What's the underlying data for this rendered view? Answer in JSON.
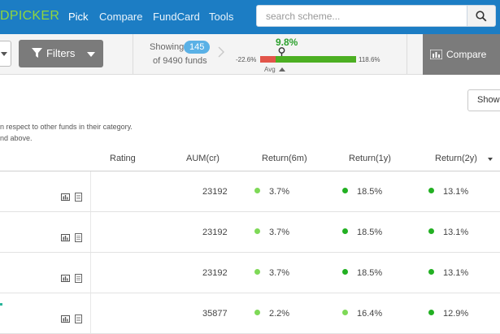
{
  "nav": {
    "brand": "DPICKER",
    "links": [
      "Pick",
      "Compare",
      "FundCard",
      "Tools"
    ],
    "active_link": "Pick"
  },
  "search": {
    "placeholder": "search scheme..."
  },
  "toolbar": {
    "filters_label": "Filters",
    "showing_label": "Showing",
    "showing_count": "145",
    "of_total": "of 9490 funds",
    "return_value": "9.8%",
    "range_min": "-22.6%",
    "range_max": "118.6%",
    "avg_label": "Avg",
    "compare_label": "Compare"
  },
  "info": {
    "show_button": "Show",
    "note_line1": "n respect to other funds in their category.",
    "note_line2": "nd above."
  },
  "table": {
    "columns": [
      "Rating",
      "AUM(cr)",
      "Return(6m)",
      "Return(1y)",
      "Return(2y)"
    ],
    "rows": [
      {
        "aum": "23192",
        "r6m": "3.7%",
        "r1y": "18.5%",
        "r2y": "13.1%"
      },
      {
        "aum": "23192",
        "r6m": "3.7%",
        "r1y": "18.5%",
        "r2y": "13.1%"
      },
      {
        "aum": "23192",
        "r6m": "3.7%",
        "r1y": "18.5%",
        "r2y": "13.1%"
      },
      {
        "aum": "35877",
        "r6m": "2.2%",
        "r1y": "16.4%",
        "r2y": "12.9%"
      }
    ]
  },
  "colors": {
    "nav_bg": "#1c7dc4",
    "brand": "#8fd63d",
    "positive": "#2da12e",
    "negative": "#e2554a",
    "dot_light": "#7ed957",
    "dot_dark": "#22b022",
    "button_grey": "#7b7b7b"
  },
  "icons": [
    "filter-icon",
    "search-icon",
    "chevron-right-icon",
    "pin-icon",
    "bar-chart-icon",
    "document-icon"
  ]
}
